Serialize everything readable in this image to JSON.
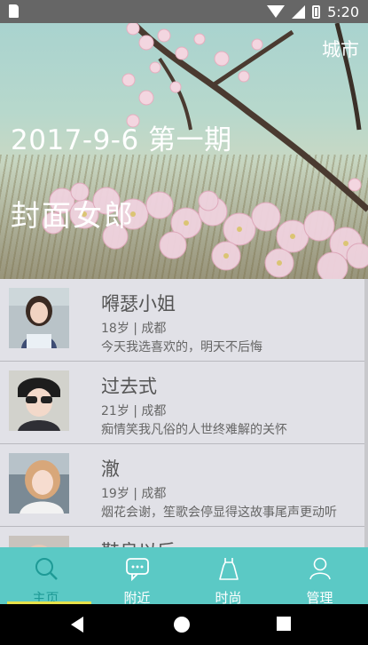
{
  "status": {
    "time": "5:20"
  },
  "hero": {
    "city_label": "城市",
    "issue": "2017-9-6  第一期",
    "title": "封面女郎"
  },
  "list": [
    {
      "name": "嘚瑟小姐",
      "meta": "18岁 | 成都",
      "motto": "今天我选喜欢的，明天不后悔"
    },
    {
      "name": "过去式",
      "meta": "21岁 | 成都",
      "motto": "痴情笑我凡俗的人世终难解的关怀"
    },
    {
      "name": "澈",
      "meta": "19岁 | 成都",
      "motto": "烟花会谢，笙歌会停显得这故事尾声更动听"
    },
    {
      "name": "鞋良以后",
      "meta": "",
      "motto": ""
    }
  ],
  "tabs": [
    {
      "label": "主页",
      "icon": "search-icon"
    },
    {
      "label": "附近",
      "icon": "chat-bubble-icon"
    },
    {
      "label": "时尚",
      "icon": "dress-icon"
    },
    {
      "label": "管理",
      "icon": "person-icon"
    }
  ],
  "colors": {
    "accent": "#5bc9c5",
    "active_label": "#1e9a96",
    "active_indicator": "#e7e14a"
  }
}
